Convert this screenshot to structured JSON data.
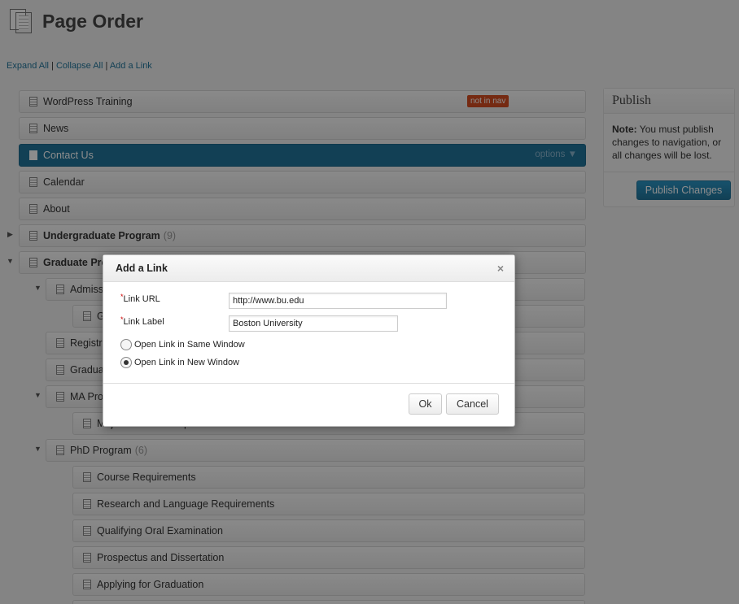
{
  "header": {
    "title": "Page Order",
    "icon": "pages-icon"
  },
  "actions": {
    "expand_all": "Expand All",
    "collapse_all": "Collapse All",
    "add_link": "Add a Link",
    "sep": "|"
  },
  "tree": {
    "rows": [
      {
        "label": "WordPress Training",
        "badge": "not in nav"
      },
      {
        "label": "News"
      },
      {
        "label": "Contact Us",
        "options": "options ▼"
      },
      {
        "label": "Calendar"
      },
      {
        "label": "About"
      },
      {
        "label": "Undergraduate Program",
        "count": "(9)"
      },
      {
        "label": "Graduate Pro"
      },
      {
        "label": "Admiss"
      },
      {
        "label": "G"
      },
      {
        "label": "Registra"
      },
      {
        "label": "Gradua"
      },
      {
        "label": "MA Pro"
      },
      {
        "label": "Major Research Paper"
      },
      {
        "label": "PhD Program",
        "count": "(6)"
      },
      {
        "label": "Course Requirements"
      },
      {
        "label": "Research and Language Requirements"
      },
      {
        "label": "Qualifying Oral Examination"
      },
      {
        "label": "Prospectus and Dissertation"
      },
      {
        "label": "Applying for Graduation"
      }
    ]
  },
  "publish": {
    "title": "Publish",
    "note_bold": "Note:",
    "note_text": " You must publish changes to navigation, or all changes will be lost.",
    "button": "Publish Changes"
  },
  "dialog": {
    "title": "Add a Link",
    "close": "×",
    "required_mark": "*",
    "url_label": "Link URL",
    "url_value": "http://www.bu.edu",
    "label_label": "Link Label",
    "label_value": "Boston University",
    "radio_same": "Open Link in Same Window",
    "radio_new": "Open Link in New Window",
    "selected": "new",
    "ok": "Ok",
    "cancel": "Cancel"
  }
}
